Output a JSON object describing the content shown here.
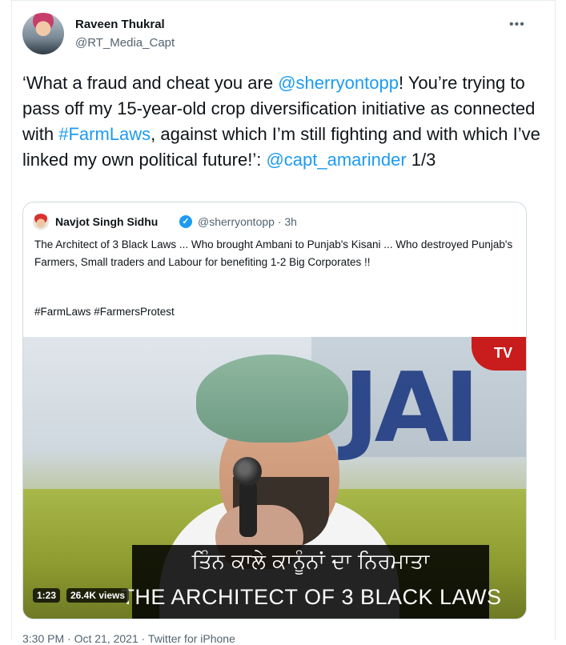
{
  "tweet": {
    "author_name": "Raveen Thukral",
    "author_handle": "@RT_Media_Capt",
    "more_label": "•••",
    "text_part1": "‘What a fraud and cheat you are ",
    "mention1": "@sherryontopp",
    "text_part2": "! You’re trying to pass off my 15-year-old crop diversification initiative as connected with ",
    "hashtag1": "#FarmLaws",
    "text_part3": ", against which I’m still fighting and with which I’ve linked my own political future!’: ",
    "mention2": "@capt_amarinder",
    "text_part4": " 1/3",
    "footer": "3:30 PM · Oct 21, 2021 · Twitter for iPhone"
  },
  "quote": {
    "author_name": "Navjot Singh Sidhu",
    "verified_mark": "✓",
    "handle_time": "@sherryontopp · 3h",
    "body": "The Architect of 3 Black Laws ... Who brought Ambani to Punjab's Kisani ... Who destroyed Punjab's Farmers, Small traders and Labour for benefiting 1-2 Big Corporates !!",
    "hashtags": "#FarmLaws #FarmersProtest",
    "video": {
      "tv_label": "TV",
      "subtitle_punjabi": "ਤਿੰਨ ਕਾਲੇ ਕਾਨੂੰਨਾਂ ਦਾ ਨਿਰਮਾਤਾ",
      "subtitle_english": "THE ARCHITECT OF 3 BLACK LAWS",
      "duration": "1:23",
      "views": "26.4K views"
    }
  },
  "colors": {
    "link": "#1d9bf0",
    "secondary_text": "#536471",
    "border": "#cfd9de"
  }
}
